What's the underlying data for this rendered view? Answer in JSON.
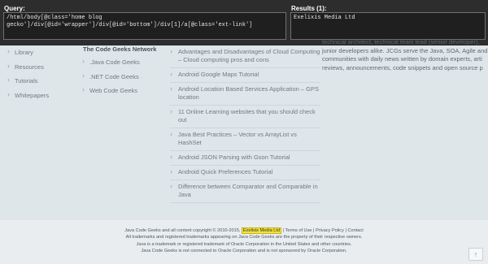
{
  "xpath": {
    "query_label": "Query:",
    "query_text": "/html/body[@class='home blog gecko']/div[@id='wrapper']/div[@id='bottom']/div[1]/a[@class='ext-link']",
    "results_label": "Results (1):",
    "results_text": "Exelixis Media Ltd"
  },
  "about_text": [
    "technical architect, technical team lead (senior developer),",
    "junior developers alike. JCGs serve the Java, SOA, Agile and",
    "communities with daily news written by domain experts, arti",
    "reviews, announcements, code snippets and open source p"
  ],
  "nav": [
    "Library",
    "Resources",
    "Tutorials",
    "Whitepapers"
  ],
  "network": {
    "title": "The Code Geeks Network",
    "items": [
      ".Java Code Geeks",
      ".NET Code Geeks",
      "Web Code Geeks"
    ]
  },
  "links": [
    "Advantages and Disadvantages of Cloud Computing – Cloud computing pros and cons",
    "Android Google Maps Tutorial",
    "Android Location Based Services Application – GPS location",
    "11 Online Learning websites that you should check out",
    "Java Best Practices – Vector vs ArrayList vs HashSet",
    "Android JSON Parsing with Gson Tutorial",
    "Android Quick Preferences Tutorial",
    "Difference between Comparator and Comparable in Java"
  ],
  "footer": {
    "line1_pre": "Java Code Geeks and all content copyright © 2010-2015,",
    "line1_link": "Exelixis Media Ltd",
    "line1_sep1": "| Terms of Use |",
    "line1_privacy": "Privacy Policy",
    "line1_sep2": "|",
    "line1_contact": "Contact",
    "line2": "All trademarks and registered trademarks appearing on Java Code Geeks are the property of their respective owners.",
    "line3": "Java is a trademark or registered trademark of Oracle Corporation in the United States and other countries.",
    "line4": "Java Code Geeks is not connected to Oracle Corporation and is not sponsored by Oracle Corporation."
  },
  "scroll_top_glyph": "↑"
}
